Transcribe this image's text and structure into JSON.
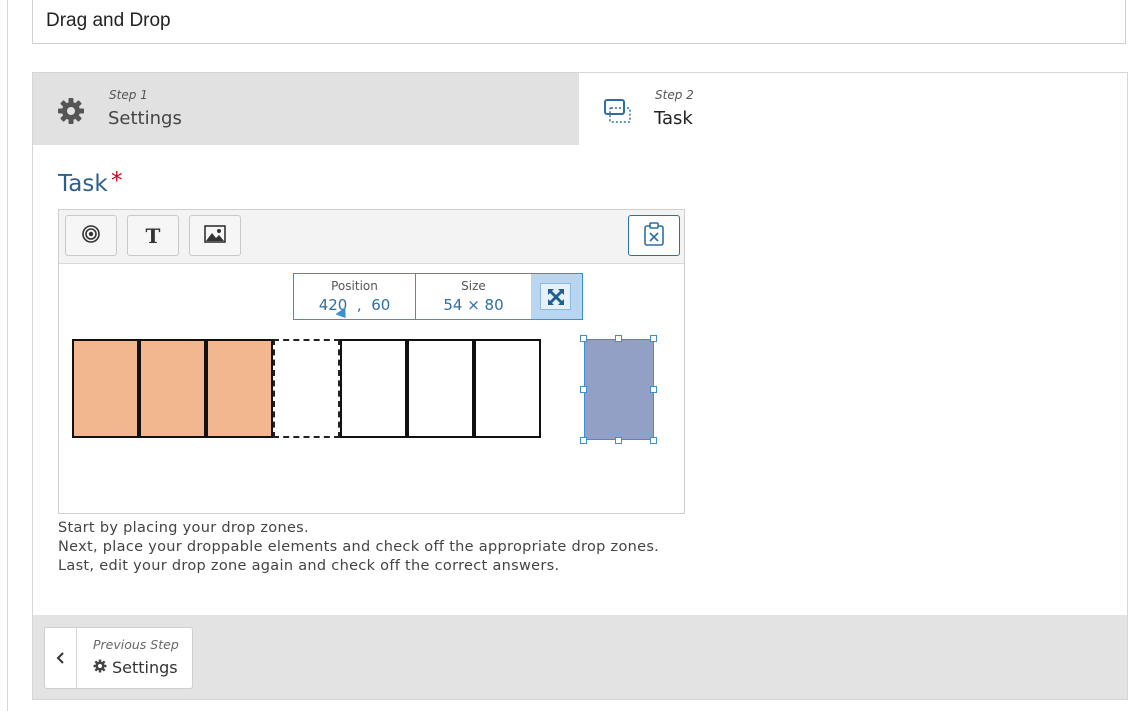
{
  "page": {
    "title": "Drag and Drop"
  },
  "steps": [
    {
      "small": "Step 1",
      "label": "Settings",
      "icon": "gear-icon"
    },
    {
      "small": "Step 2",
      "label": "Task",
      "icon": "dropzone-icon"
    }
  ],
  "task": {
    "label": "Task",
    "required_mark": "*"
  },
  "toolbar": {
    "buttons": [
      {
        "name": "dropzone-tool-button",
        "icon": "target-icon"
      },
      {
        "name": "text-tool-button",
        "glyph": "T"
      },
      {
        "name": "image-tool-button",
        "icon": "image-icon"
      },
      {
        "name": "paste-button",
        "icon": "clipboard-remove-icon"
      }
    ]
  },
  "popup": {
    "position_label": "Position",
    "position_x": "420",
    "position_sep": ",",
    "position_y": "60",
    "size_label": "Size",
    "size_value": "54 × 80",
    "fit_icon": "expand-icon"
  },
  "canvas": {
    "cells": [
      {
        "state": "filled"
      },
      {
        "state": "filled"
      },
      {
        "state": "filled"
      },
      {
        "state": "dashed"
      },
      {
        "state": "empty"
      },
      {
        "state": "empty"
      },
      {
        "state": "empty"
      }
    ],
    "fill_color": "#f2b78f",
    "selected_color": "#93a0c5"
  },
  "help": {
    "line1": "Start by placing your drop zones.",
    "line2": "Next, place your droppable elements and check off the appropriate drop zones.",
    "line3": "Last, edit your drop zone again and check off the correct answers."
  },
  "footer": {
    "prev_small": "Previous Step",
    "prev_label": "Settings",
    "prev_icon": "gear-icon"
  },
  "colors": {
    "accent": "#2e6fa3",
    "required": "#d1001f"
  }
}
